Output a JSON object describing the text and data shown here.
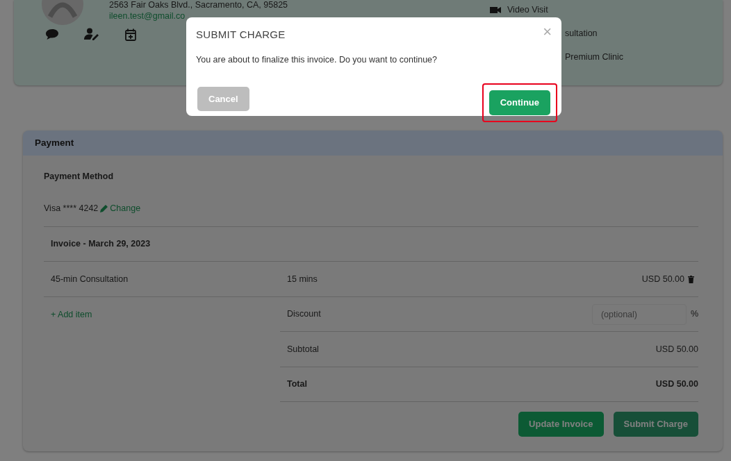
{
  "patient": {
    "address": "2563 Fair Oaks Blvd., Sacramento, CA, 95825",
    "email": "ileen.test@gmail.co"
  },
  "appointment": {
    "items": [
      {
        "kind": "video",
        "text": "Video Visit"
      },
      {
        "kind": "plain",
        "text": "sultation"
      },
      {
        "kind": "plain",
        "text": "Premium Clinic"
      }
    ]
  },
  "modal": {
    "title": "SUBMIT CHARGE",
    "close": "×",
    "message": "You are about to finalize this invoice. Do you want to continue?",
    "buttons": [
      {
        "label": "Cancel",
        "kind": "secondary",
        "highlighted": false
      },
      {
        "label": "Continue",
        "kind": "primary",
        "highlighted": true
      }
    ]
  },
  "payment": {
    "title": "Payment",
    "method_label": "Payment Method",
    "card": "Visa **** 4242",
    "change_link": "Change",
    "invoice_title": "Invoice - March 29, 2023",
    "line_items": [
      {
        "name": "45-min Consultation",
        "duration": "15 mins",
        "amount": "USD 50.00"
      }
    ],
    "add_item": "+ Add item",
    "discount": {
      "label": "Discount",
      "placeholder": "(optional)",
      "unit": "%"
    },
    "summary": [
      {
        "label": "Subtotal",
        "amount": "USD 50.00",
        "bold": false
      },
      {
        "label": "Total",
        "amount": "USD 50.00",
        "bold": true
      }
    ],
    "buttons": [
      {
        "label": "Update Invoice",
        "kind": "update"
      },
      {
        "label": "Submit Charge",
        "kind": "submit"
      }
    ]
  }
}
